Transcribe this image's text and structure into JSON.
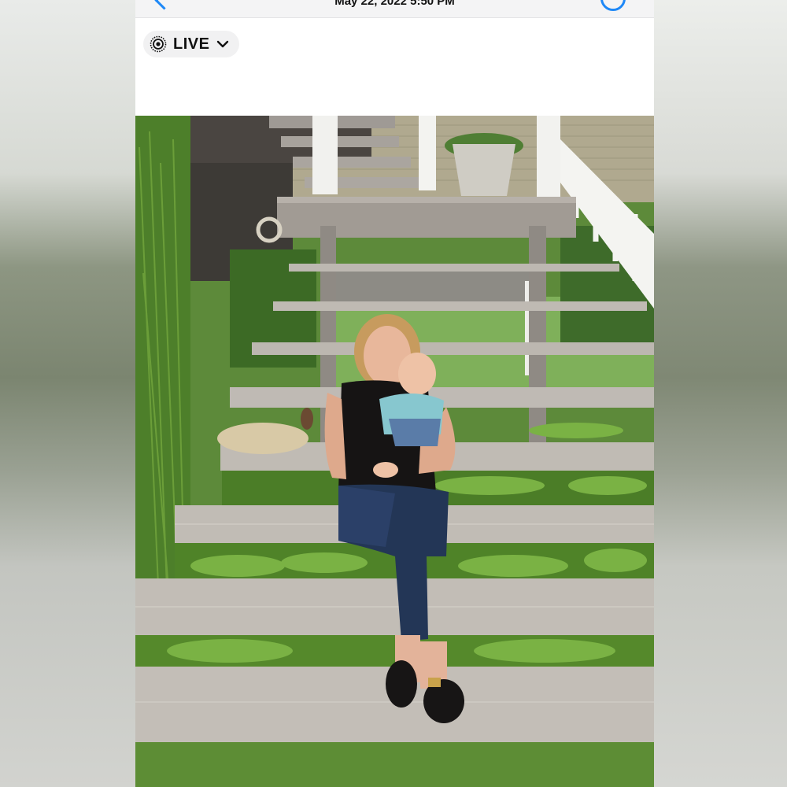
{
  "header": {
    "date_time": "May 22, 2022  5:50 PM",
    "back_icon": "chevron-left-icon",
    "info_icon": "info-icon"
  },
  "live_photo": {
    "label": "LIVE",
    "icon": "live-photo-icon",
    "dropdown_icon": "chevron-down-icon"
  },
  "colors": {
    "accent": "#1e88f7",
    "steps": "#b9b4ad",
    "fern": "#5f9a2f"
  }
}
